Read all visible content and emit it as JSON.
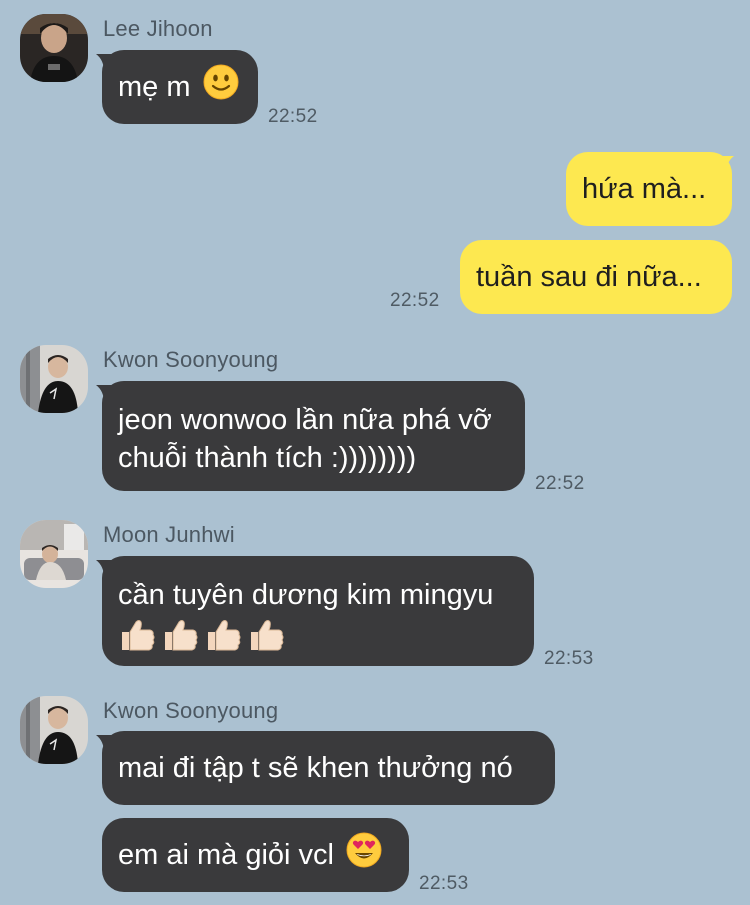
{
  "messages": [
    {
      "sender": "Lee Jihoon",
      "text": "mẹ m",
      "emoji": "slightly-smiling-face",
      "time": "22:52"
    },
    {
      "text": "hứa mà..."
    },
    {
      "text": "tuần sau đi nữa...",
      "time": "22:52"
    },
    {
      "sender": "Kwon Soonyoung",
      "line1": "jeon wonwoo lần nữa phá vỡ",
      "line2": "chuỗi thành tích :))))))))",
      "time": "22:52"
    },
    {
      "sender": "Moon Junhwi",
      "line1": "cần tuyên dương kim mingyu",
      "emoji": "thumbs-up x4",
      "time": "22:53"
    },
    {
      "sender": "Kwon Soonyoung",
      "text": "mai đi tập t sẽ khen thưởng nó"
    },
    {
      "text": "em ai mà giỏi vcl",
      "emoji": "heart-eyes-face",
      "time": "22:53"
    }
  ],
  "colors": {
    "background": "#abc1d1",
    "incoming_bubble": "#3a3a3c",
    "outgoing_bubble": "#fde850",
    "incoming_text": "#ffffff",
    "outgoing_text": "#1f1f1f"
  }
}
